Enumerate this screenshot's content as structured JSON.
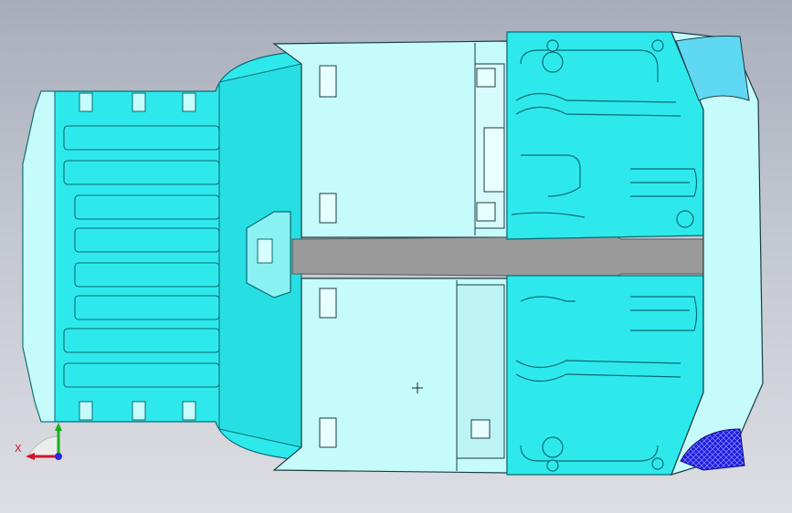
{
  "app": {
    "title": ""
  },
  "viewport": {
    "background": "#b7bcc6",
    "part_colors": {
      "floor_cyan": "#2ee9ec",
      "floor_dark_edge": "#0aa7b0",
      "panel_light": "#c6fbfb",
      "panel_edge": "#1b3b44",
      "gray_channel": "#9a9a9a",
      "blue_mesh": "#1c1ce0"
    }
  },
  "triad": {
    "x_label": "X",
    "x_color": "#d0142c",
    "y_color": "#18b318",
    "z_color": "#2a2ad8"
  }
}
